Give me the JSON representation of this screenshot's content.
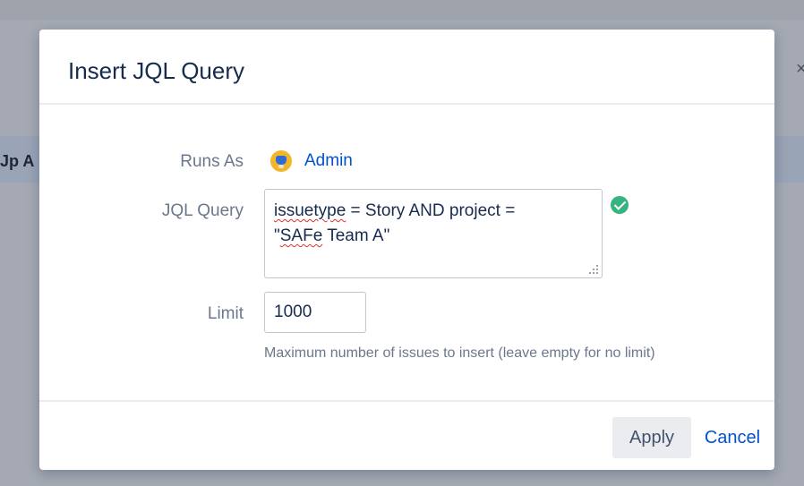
{
  "background": {
    "partial_text": "Jp A",
    "close_glyph": "×"
  },
  "dialog": {
    "title": "Insert JQL Query",
    "runs_as": {
      "label": "Runs As",
      "user": "Admin",
      "avatar_icon": "user-avatar"
    },
    "jql": {
      "label": "JQL Query",
      "word1": "issuetype",
      "rest1": " = Story AND project =",
      "line2_prefix": "\"",
      "word2": "SAFe",
      "rest2": " Team A\"",
      "valid_icon": "check-circle-icon"
    },
    "limit": {
      "label": "Limit",
      "value": "1000",
      "help": "Maximum number of issues to insert (leave empty for no limit)"
    },
    "footer": {
      "apply_label": "Apply",
      "cancel_label": "Cancel"
    }
  },
  "colors": {
    "primary_link": "#0052cc",
    "success": "#36b37e",
    "overlay": "#a4a9b3"
  }
}
